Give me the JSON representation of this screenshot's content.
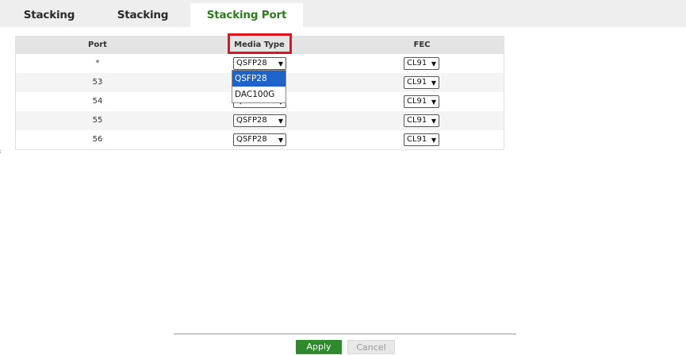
{
  "tabs": [
    {
      "label": "Stacking Status"
    },
    {
      "label": "Stacking Setup"
    },
    {
      "label": "Stacking Port Setup"
    }
  ],
  "table": {
    "headers": {
      "port": "Port",
      "media_type": "Media Type",
      "fec": "FEC"
    },
    "rows": [
      {
        "port": "*",
        "media_type": "QSFP28",
        "fec": "CL91"
      },
      {
        "port": "53",
        "media_type": "QSFP28",
        "fec": "CL91"
      },
      {
        "port": "54",
        "media_type": "QSFP28",
        "fec": "CL91"
      },
      {
        "port": "55",
        "media_type": "QSFP28",
        "fec": "CL91"
      },
      {
        "port": "56",
        "media_type": "QSFP28",
        "fec": "CL91"
      }
    ]
  },
  "dropdown": {
    "options": [
      "QSFP28",
      "DAC100G"
    ],
    "selected": "QSFP28"
  },
  "buttons": {
    "apply": "Apply",
    "cancel": "Cancel"
  },
  "icons": {
    "select_arrow": "chevron-down-icon"
  },
  "colors": {
    "accent": "#2e7d1f",
    "highlight": "#e0141f",
    "selected": "#1e64c8",
    "apply_bg": "#2f8a2d"
  }
}
